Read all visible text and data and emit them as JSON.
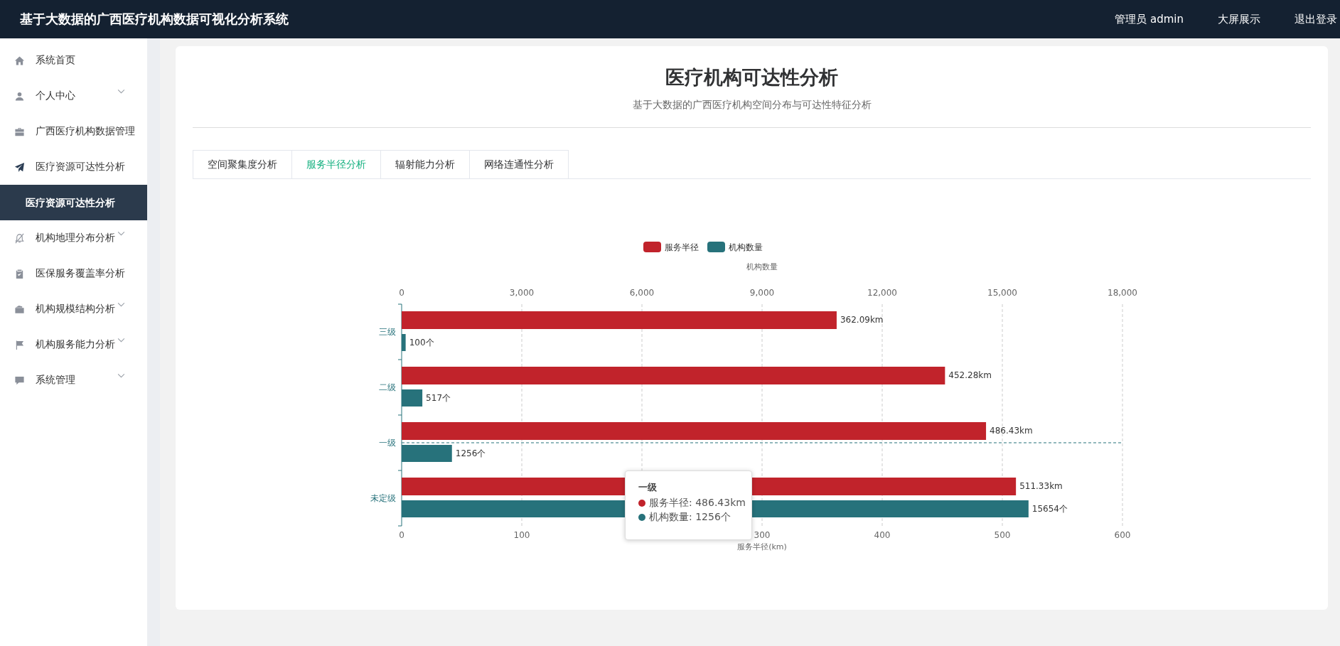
{
  "header": {
    "title": "基于大数据的广西医疗机构数据可视化分析系统",
    "links": [
      "管理员 admin",
      "大屏展示",
      "退出登录"
    ]
  },
  "sidebar": {
    "items": [
      {
        "label": "系统首页",
        "collapsible": false
      },
      {
        "label": "个人中心",
        "collapsible": true
      },
      {
        "label": "广西医疗机构数据管理",
        "collapsible": false
      },
      {
        "label": "医疗资源可达性分析",
        "collapsible": false,
        "children": [
          {
            "label": "医疗资源可达性分析",
            "selected": true
          }
        ]
      },
      {
        "label": "机构地理分布分析",
        "collapsible": true
      },
      {
        "label": "医保服务覆盖率分析",
        "collapsible": false
      },
      {
        "label": "机构规模结构分析",
        "collapsible": true
      },
      {
        "label": "机构服务能力分析",
        "collapsible": true
      },
      {
        "label": "系统管理",
        "collapsible": true
      }
    ]
  },
  "page": {
    "title": "医疗机构可达性分析",
    "subtitle": "基于大数据的广西医疗机构空间分布与可达性特征分析"
  },
  "tabs": [
    {
      "label": "空间聚集度分析",
      "selected": false
    },
    {
      "label": "服务半径分析",
      "selected": true
    },
    {
      "label": "辐射能力分析",
      "selected": false
    },
    {
      "label": "网络连通性分析",
      "selected": false
    }
  ],
  "chart_data": {
    "type": "bar",
    "orientation": "horizontal",
    "grid": true,
    "legend": true,
    "ref_lines": [
      {
        "axis": "y",
        "value": "一级"
      }
    ],
    "categories": [
      "三级",
      "二级",
      "一级",
      "未定级"
    ],
    "xlabel": "服务半径(km)",
    "xlim": [
      0,
      600
    ],
    "xticks": [
      0,
      100,
      300,
      400,
      500,
      600
    ],
    "x2label": "机构数量",
    "x2lim": [
      0,
      18000
    ],
    "x2ticks": [
      0,
      {
        "value": 3000,
        "label": "3,000"
      },
      {
        "value": 6000,
        "label": "6,000"
      },
      {
        "value": 9000,
        "label": "9,000"
      },
      {
        "value": 12000,
        "label": "12,000"
      },
      {
        "value": 15000,
        "label": "15,000"
      },
      {
        "value": 18000,
        "label": "18,000"
      }
    ],
    "series": [
      {
        "name": "服务半径",
        "color": "#c1232b",
        "values": [
          362.09,
          452.28,
          486.43,
          511.33
        ],
        "value_labels": [
          "362.09km",
          "452.28km",
          "486.43km",
          "511.33km"
        ]
      },
      {
        "name": "机构数量",
        "color": "#27727b",
        "axis": "x2",
        "values": [
          100,
          517,
          1256,
          15654
        ],
        "value_labels": [
          "100个",
          "517个",
          "1256个",
          "15654个"
        ]
      }
    ]
  },
  "tooltip": {
    "title": "一级",
    "rows": [
      {
        "text": "服务半径: 486.43km",
        "color": "#c1232b"
      },
      {
        "text": "机构数量: 1256个",
        "color": "#27727b"
      }
    ]
  }
}
